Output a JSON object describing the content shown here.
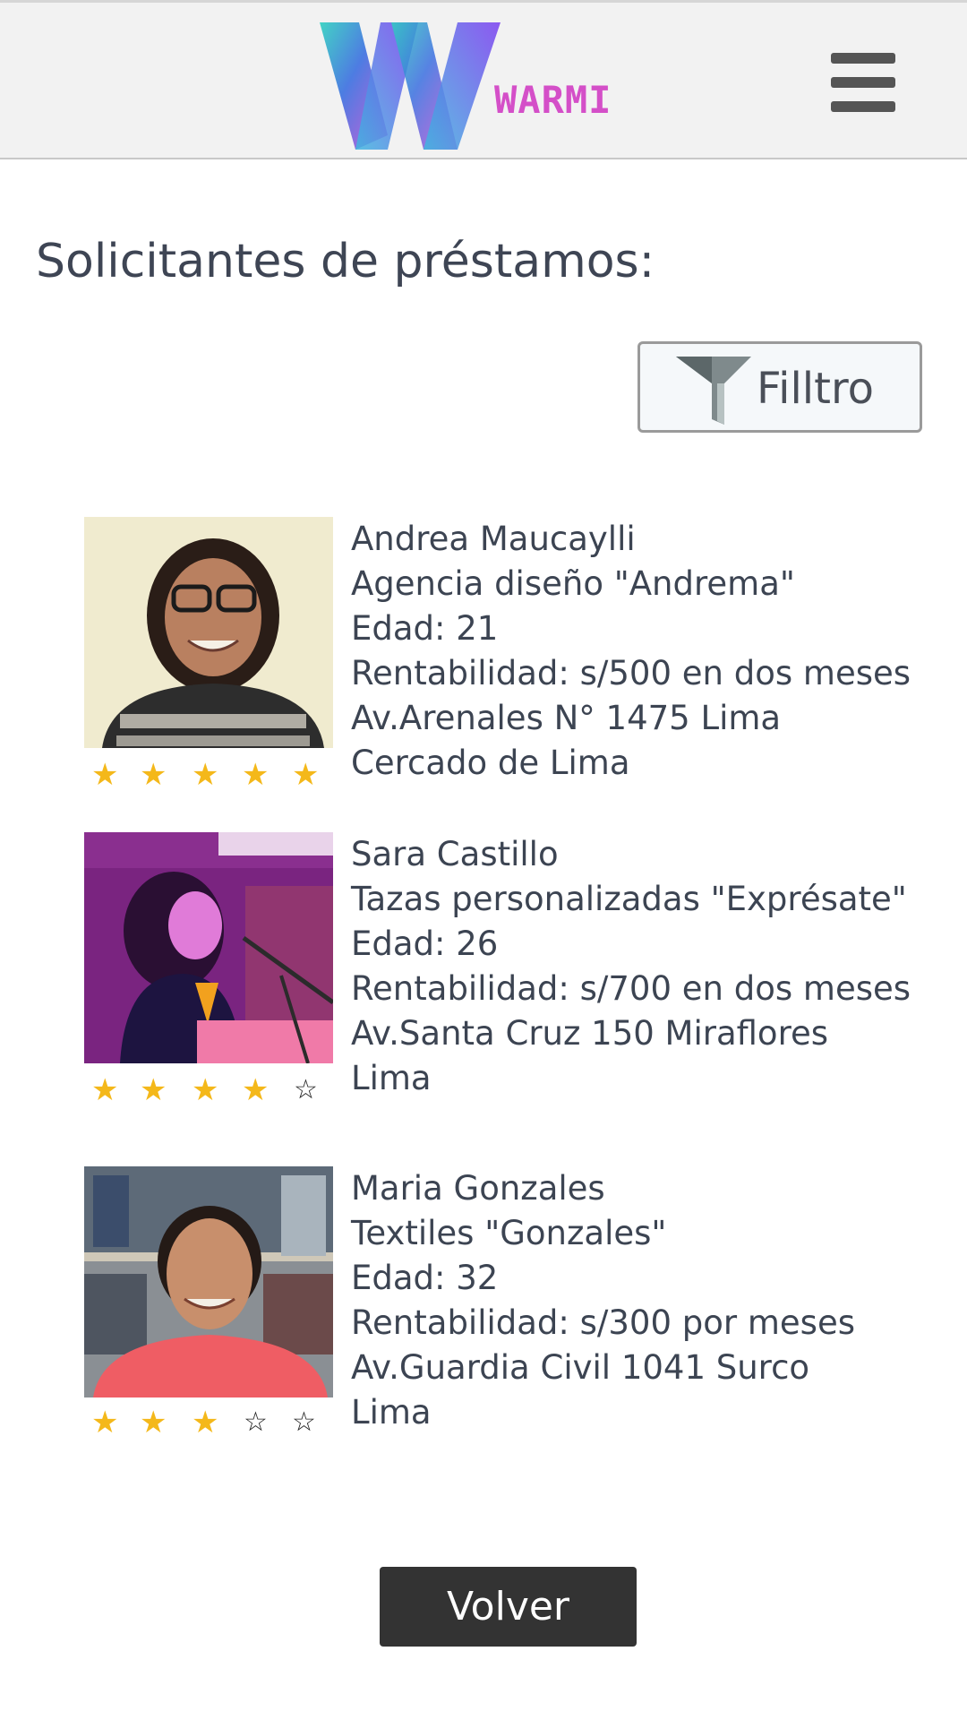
{
  "header": {
    "logo_text": "WARMI",
    "menu_icon": "hamburger-icon"
  },
  "main": {
    "title": "Solicitantes de préstamos:",
    "filter": {
      "label": "Filltro",
      "icon": "funnel-icon"
    },
    "applicants": [
      {
        "name": "Andrea Maucaylli",
        "business": "Agencia diseño \"Andrema\"",
        "age": "Edad: 21",
        "profitability": "Rentabilidad: s/500 en dos meses",
        "address_line1": "Av.Arenales N° 1475 Lima",
        "address_line2": "Cercado de Lima",
        "rating": 5
      },
      {
        "name": "Sara Castillo",
        "business": "Tazas personalizadas \"Exprésate\"",
        "age": "Edad: 26",
        "profitability": "Rentabilidad: s/700 en dos meses",
        "address_line1": "Av.Santa Cruz 150 Miraflores",
        "address_line2": "Lima",
        "rating": 4
      },
      {
        "name": "Maria Gonzales",
        "business": "Textiles \"Gonzales\"",
        "age": "Edad: 32",
        "profitability": "Rentabilidad: s/300 por meses",
        "address_line1": "Av.Guardia Civil 1041  Surco",
        "address_line2": "Lima",
        "rating": 3
      }
    ],
    "back_button_label": "Volver"
  },
  "colors": {
    "star_filled": "#f4b81a",
    "header_bg": "#f2f2f2",
    "button_dark": "#333333",
    "logo_pink": "#d44fc8"
  }
}
